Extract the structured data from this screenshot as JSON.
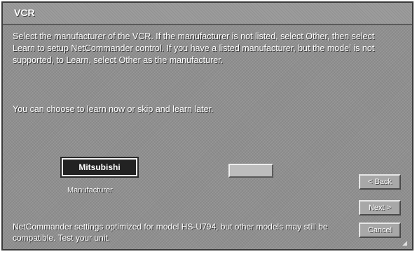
{
  "window": {
    "title": "VCR"
  },
  "instructions": {
    "paragraph1": "Select the manufacturer of the VCR. If the manufacturer is not listed, select Other, then select Learn to setup NetCommander control. If you have a listed manufacturer, but the model is not supported, to Learn, select Other as the manufacturer.",
    "paragraph2": "You can choose to learn now or skip and learn later."
  },
  "manufacturer": {
    "value": "Mitsubishi",
    "label": "Manufacturer"
  },
  "buttons": {
    "back": "< Back",
    "next": "Next >",
    "cancel": "Cancel"
  },
  "footer": {
    "note": "NetCommander settings optimized for model HS-U794, but other models may still be compatible. Test your unit."
  },
  "colors": {
    "panel": "#8e8e8e",
    "text": "#ffffff",
    "field_bg": "#222222"
  }
}
